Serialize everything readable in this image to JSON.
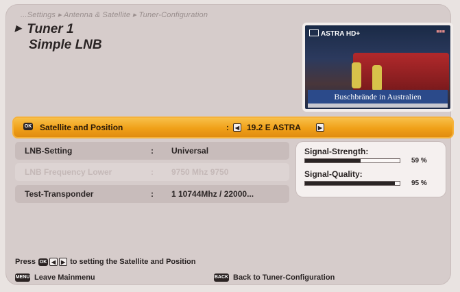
{
  "breadcrumb": "...Settings ▸ Antenna & Satellite ▸ Tuner-Configuration",
  "header": {
    "title": "Tuner 1",
    "subtitle": "Simple LNB"
  },
  "preview": {
    "channel": "ASTRA HD+",
    "caption": "Buschbrände in Australien"
  },
  "rows": {
    "satellite": {
      "label": "Satellite and Position",
      "value": "19.2 E ASTRA",
      "key": "OK"
    },
    "lnb": {
      "label": "LNB-Setting",
      "value": "Universal"
    },
    "disabled": {
      "label": "LNB Frequency Lower",
      "value": "9750  Mhz  9750"
    },
    "transponder": {
      "label": "Test-Transponder",
      "value": "1  10744Mhz / 22000..."
    }
  },
  "separator": ":",
  "signal": {
    "strength_label": "Signal-Strength:",
    "strength_pct": 59,
    "strength_text": "59 %",
    "quality_label": "Signal-Quality:",
    "quality_pct": 95,
    "quality_text": "95 %"
  },
  "help": {
    "press": "Press",
    "ok_key": "OK",
    "text": "to setting the Satellite and Position"
  },
  "footer": {
    "menu_key": "MENU",
    "leave": "Leave Mainmenu",
    "back_key": "BACK",
    "back": "Back to Tuner-Configuration"
  },
  "colors": {
    "highlight": "#f0a018",
    "panel": "#d6cccb",
    "row": "#c8bcbb"
  }
}
